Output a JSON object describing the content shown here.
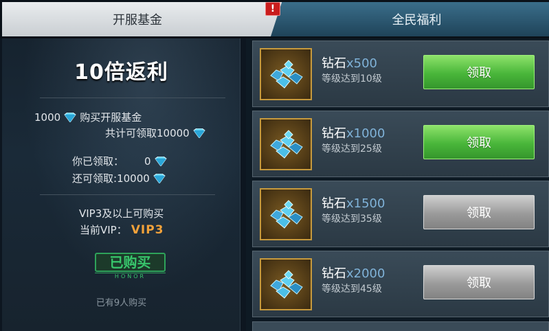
{
  "tabs": {
    "fund_label": "开服基金",
    "welfare_label": "全民福利",
    "alert_badge": "!"
  },
  "fund": {
    "title": "10倍返利",
    "cost_amount": "1000",
    "cost_text": "购买开服基金",
    "total_text": "共计可领取10000",
    "claimed_label": "你已领取：",
    "claimed_value": "0",
    "remaining_label": "还可领取:",
    "remaining_value": "10000",
    "vip_requirement": "VIP3及以上可购买",
    "current_vip_label": "当前VIP：",
    "current_vip_value": "VIP3",
    "stamp_text": "已购买",
    "stamp_sub": "HONOR",
    "buyers_text": "已有9人购买"
  },
  "rewards": [
    {
      "name": "钻石",
      "qty": "x500",
      "requirement": "等级达到10级",
      "button": "领取",
      "state": "active"
    },
    {
      "name": "钻石",
      "qty": "x1000",
      "requirement": "等级达到25级",
      "button": "领取",
      "state": "active"
    },
    {
      "name": "钻石",
      "qty": "x1500",
      "requirement": "等级达到35级",
      "button": "领取",
      "state": "disabled"
    },
    {
      "name": "钻石",
      "qty": "x2000",
      "requirement": "等级达到45级",
      "button": "领取",
      "state": "disabled"
    }
  ],
  "icons": {
    "gem": "diamond-icon",
    "reward_item": "diamond-pile-icon"
  },
  "colors": {
    "claim_active": "#49b63a",
    "claim_disabled": "#9a9a9a",
    "vip_accent": "#f2a23a",
    "stamp_green": "#38c66c"
  }
}
